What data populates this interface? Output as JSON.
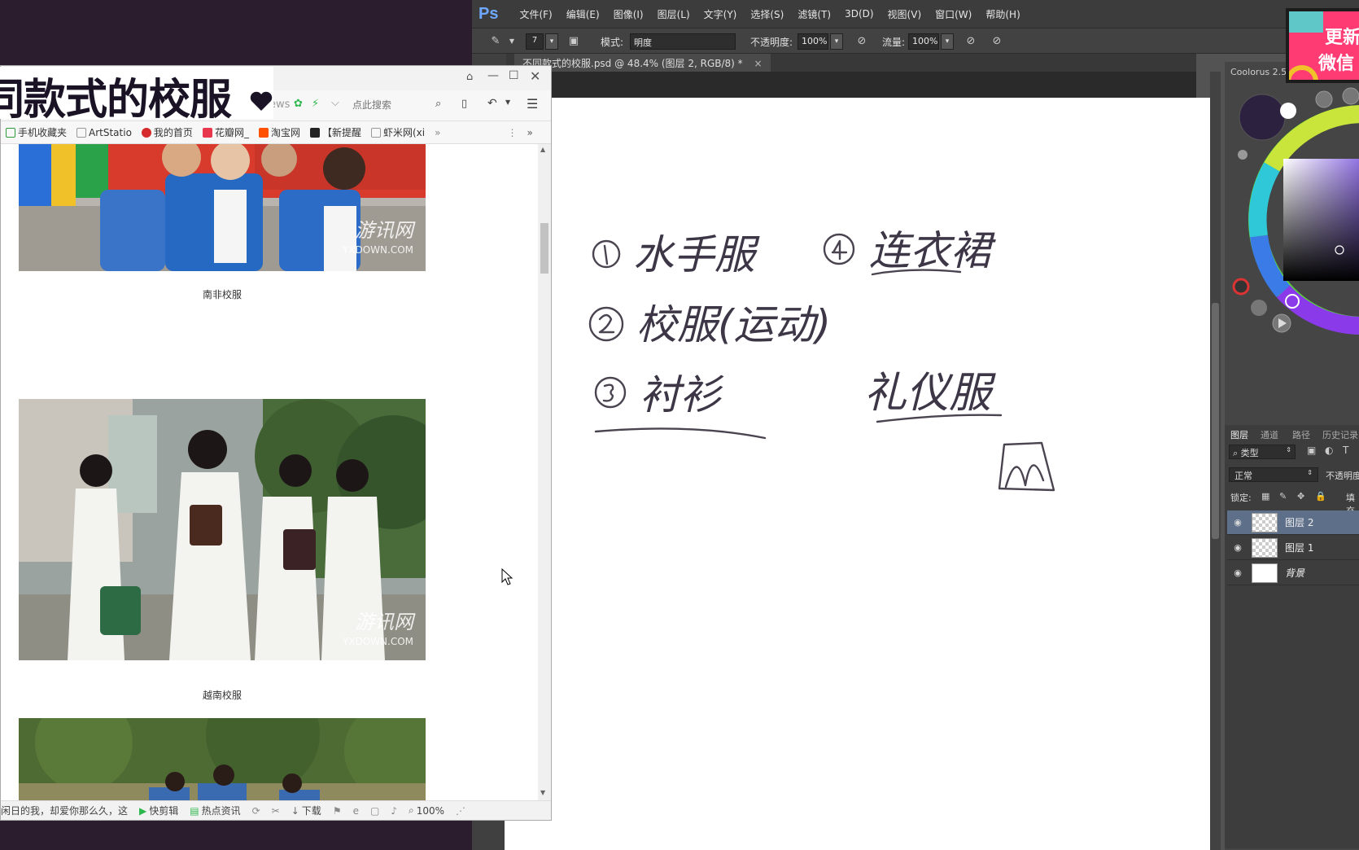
{
  "photoshop": {
    "logo": "Ps",
    "menu": [
      "文件(F)",
      "编辑(E)",
      "图像(I)",
      "图层(L)",
      "文字(Y)",
      "选择(S)",
      "滤镜(T)",
      "3D(D)",
      "视图(V)",
      "窗口(W)",
      "帮助(H)"
    ],
    "options": {
      "brush_size": "7",
      "mode_label": "模式:",
      "mode_value": "明度",
      "opacity_label": "不透明度:",
      "opacity_value": "100%",
      "flow_label": "流量:",
      "flow_value": "100%"
    },
    "document_tab": "不同款式的校服.psd @ 48.4% (图层 2, RGB/8) *",
    "canvas_notes": [
      "水手服",
      "连衣裙",
      "校服(运动)",
      "衬衫",
      "礼仪服"
    ],
    "panels": {
      "coolorus_title": "Coolorus 2.5",
      "tabs": [
        "图层",
        "通道",
        "路径",
        "历史记录"
      ],
      "filter_kind": "类型",
      "blend_mode": "正常",
      "opacity_label": "不透明度",
      "lock_label": "锁定:",
      "fill_label": "填充",
      "layers": [
        {
          "name": "图层 2",
          "selected": true
        },
        {
          "name": "图层 1",
          "selected": false
        },
        {
          "name": "背景",
          "selected": false
        }
      ]
    }
  },
  "browser": {
    "toolbar": {
      "news_label": "ews",
      "search_placeholder": "点此搜索"
    },
    "bookmarks": [
      "手机收藏夹",
      "ArtStatio",
      "我的首页",
      "花瓣网_",
      "淘宝网",
      "【新提醒",
      "虾米网(xi"
    ],
    "captions": [
      "南非校服",
      "越南校服"
    ],
    "status": {
      "ticker": "闲日的我，却爱你那么久，这样",
      "clip": "快剪辑",
      "news": "热点资讯",
      "download": "下载",
      "zoom": "100%"
    }
  },
  "overlay": {
    "title": "同款式的校服",
    "badge_line1": "更新",
    "badge_line2": "微信"
  }
}
